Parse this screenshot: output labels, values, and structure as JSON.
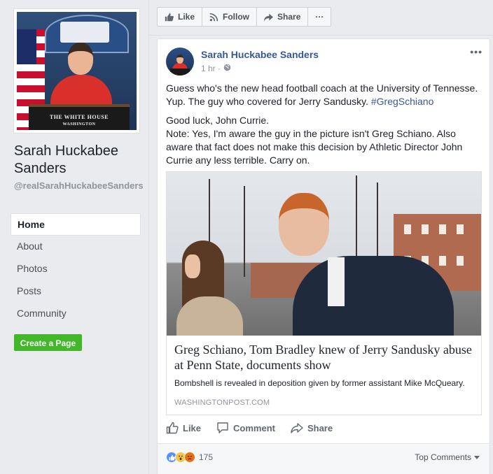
{
  "page": {
    "name": "Sarah Huckabee Sanders",
    "handle": "@realSarahHuckabeeSanders",
    "podium_text": "THE WHITE HOUSE\nWASHINGTON"
  },
  "nav": {
    "items": [
      {
        "label": "Home",
        "active": true
      },
      {
        "label": "About"
      },
      {
        "label": "Photos"
      },
      {
        "label": "Posts"
      },
      {
        "label": "Community"
      }
    ],
    "create_page": "Create a Page"
  },
  "actionbar": {
    "like": "Like",
    "follow": "Follow",
    "share": "Share",
    "more": "···"
  },
  "post": {
    "author": "Sarah Huckabee Sanders",
    "time": "1 hr ·",
    "text1": "Guess who's the new head football coach at the University of Tennesse. Yup. The guy who covered for Jerry Sandusky.",
    "hashtag": "#GregSchiano",
    "text2": "Good luck, John Currie.",
    "text3": "Note: Yes, I'm aware the guy in the picture isn't Greg Schiano. Also aware that fact does not make this decision by Athletic Director John Currie any less terrible. Carry on.",
    "link": {
      "title": "Greg Schiano, Tom Bradley knew of Jerry Sandusky abuse at Penn State, documents show",
      "description": "Bombshell is revealed in deposition given by former assistant Mike McQueary.",
      "domain": "WASHINGTONPOST.COM"
    },
    "actions": {
      "like": "Like",
      "comment": "Comment",
      "share": "Share"
    },
    "reactions": {
      "count": "175",
      "types": [
        "like",
        "wow",
        "angry"
      ]
    },
    "sort": "Top Comments"
  },
  "colors": {
    "link_blue": "#365899",
    "create_green": "#42b72a",
    "like_blue": "#5890ff"
  }
}
